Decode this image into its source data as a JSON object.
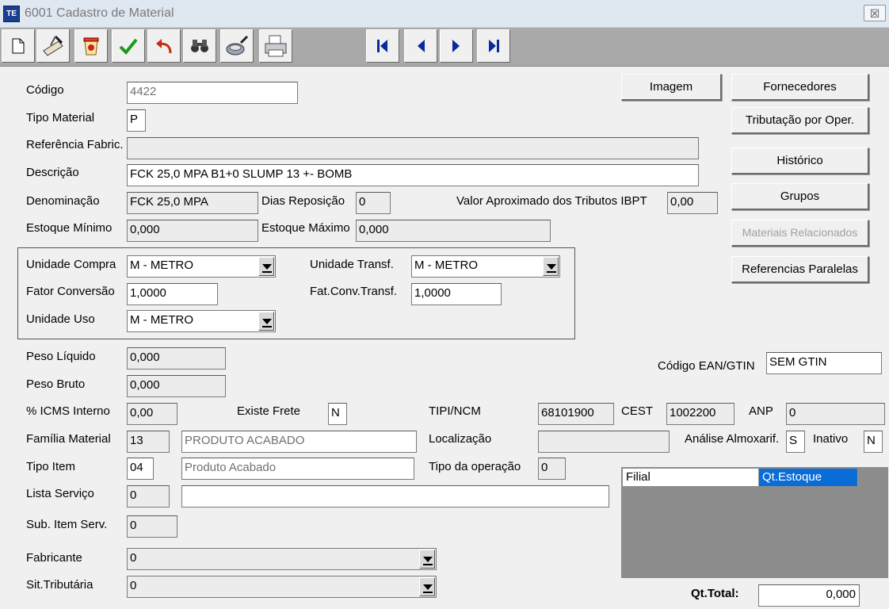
{
  "window": {
    "title": "6001 Cadastro de Material",
    "app_icon_text": "TE",
    "close_glyph": "☒"
  },
  "toolbar": {
    "buttons": [
      {
        "name": "new-doc-icon"
      },
      {
        "name": "edit-pen-icon"
      },
      {
        "name": "delete-icon"
      },
      {
        "name": "confirm-check-icon"
      },
      {
        "name": "undo-icon"
      },
      {
        "name": "search-binoculars-icon"
      },
      {
        "name": "filter-icon"
      },
      {
        "name": "print-icon"
      }
    ],
    "nav": [
      {
        "name": "first-record-icon"
      },
      {
        "name": "prev-record-icon"
      },
      {
        "name": "next-record-icon"
      },
      {
        "name": "last-record-icon"
      }
    ]
  },
  "labels": {
    "codigo": "Código",
    "tipo_material": "Tipo Material",
    "referencia": "Referência Fabric.",
    "descricao": "Descrição",
    "denominacao": "Denominação",
    "dias_reposicao": "Dias Reposição",
    "ibpt": "Valor Aproximado dos Tributos IBPT",
    "estoque_minimo": "Estoque Mínimo",
    "estoque_maximo": "Estoque Máximo",
    "unidade_compra": "Unidade Compra",
    "unidade_transf": "Unidade Transf.",
    "fator_conversao": "Fator Conversão",
    "fat_conv_transf": "Fat.Conv.Transf.",
    "unidade_uso": "Unidade Uso",
    "peso_liquido": "Peso Líquido",
    "peso_bruto": "Peso Bruto",
    "codigo_ean": "Código EAN/GTIN",
    "icms": "% ICMS Interno",
    "existe_frete": "Existe Frete",
    "tipi_ncm": "TIPI/NCM",
    "cest": "CEST",
    "anp": "ANP",
    "familia": "Família Material",
    "localizacao": "Localização",
    "analise": "Análise Almoxarif.",
    "inativo": "Inativo",
    "tipo_item": "Tipo Item",
    "tipo_operacao": "Tipo da operação",
    "lista_servico": "Lista Serviço",
    "sub_item": "Sub. Item Serv.",
    "fabricante": "Fabricante",
    "sit_tributaria": "Sit.Tributária",
    "qt_total": "Qt.Total:"
  },
  "values": {
    "codigo": "4422",
    "tipo_material": "P",
    "referencia": "",
    "descricao": "FCK 25,0 MPA B1+0 SLUMP 13 +- BOMB",
    "denominacao": "FCK 25,0 MPA",
    "dias_reposicao": "0",
    "ibpt": "0,00",
    "estoque_minimo": "0,000",
    "estoque_maximo": "0,000",
    "unidade_compra": "M - METRO",
    "unidade_transf": "M - METRO",
    "fator_conversao": "1,0000",
    "fat_conv_transf": "1,0000",
    "unidade_uso": "M - METRO",
    "peso_liquido": "0,000",
    "peso_bruto": "0,000",
    "codigo_ean": "SEM GTIN",
    "icms": "0,00",
    "existe_frete": "N",
    "tipi_ncm": "68101900",
    "cest": "1002200",
    "anp": "0",
    "familia_cod": "13",
    "familia_desc": "PRODUTO ACABADO",
    "localizacao": "",
    "analise": "S",
    "inativo": "N",
    "tipo_item_cod": "04",
    "tipo_item_desc": "Produto Acabado",
    "tipo_operacao": "0",
    "lista_servico_cod": "0",
    "lista_servico_desc": "",
    "sub_item": "0",
    "fabricante": "0",
    "sit_tributaria": "0",
    "qt_total": "0,000"
  },
  "buttons": {
    "imagem": "Imagem",
    "fornecedores": "Fornecedores",
    "tributacao": "Tributação por Oper.",
    "historico": "Histórico",
    "grupos": "Grupos",
    "materiais": "Materiais Relacionados",
    "referencias": "Referencias Paralelas"
  },
  "stock_grid": {
    "columns": [
      "Filial",
      "Qt.Estoque"
    ],
    "rows": []
  },
  "colors": {
    "title_bg": "#dfe7f1",
    "toolbar_bg": "#a9a9a9",
    "grid_bg": "#8c8c8c",
    "grid_selected_header": "#0a6cd6"
  }
}
